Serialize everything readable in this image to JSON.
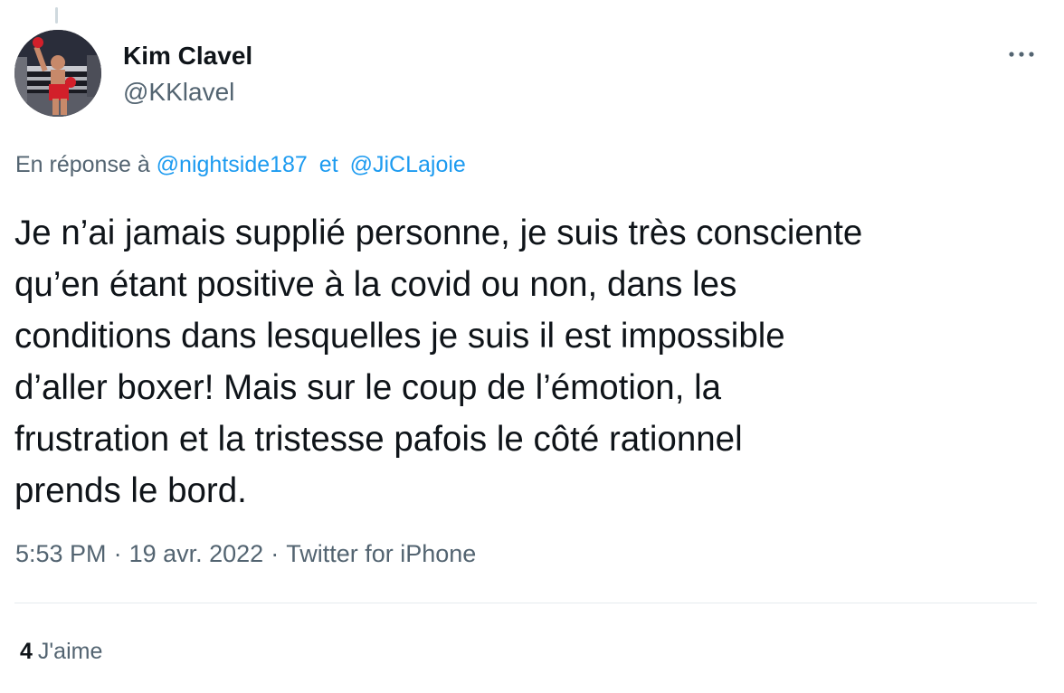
{
  "author": {
    "display_name": "Kim Clavel",
    "handle": "@KKlavel"
  },
  "reply_to": {
    "prefix": "En réponse à",
    "mentions": [
      "@nightside187",
      "@JiCLajoie"
    ],
    "separator": "et"
  },
  "tweet": {
    "text": "Je n’ai jamais supplié personne, je suis très consciente\nqu’en étant positive à la covid ou non, dans les\nconditions dans lesquelles je suis il est impossible\nd’aller boxer! Mais sur le coup de l’émotion, la\nfrustration et la tristesse pafois le côté rationnel\nprends le bord."
  },
  "meta": {
    "time": "5:53 PM",
    "date": "19 avr. 2022",
    "source": "Twitter for iPhone",
    "separator": "·"
  },
  "stats": {
    "likes_count": "4",
    "likes_label": "J'aime"
  },
  "icons": {
    "more": "more-horizontal-icon"
  },
  "colors": {
    "link": "#1d9bf0",
    "text": "#0f1419",
    "secondary": "#536471",
    "divider": "#e6ebee"
  }
}
